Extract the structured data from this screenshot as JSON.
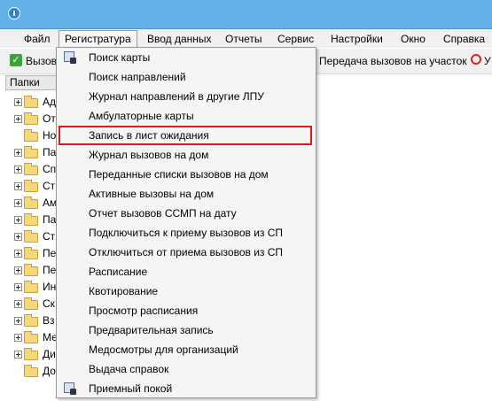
{
  "menubar": {
    "items": [
      "Файл",
      "Регистратура",
      "Ввод данных",
      "Отчеты",
      "Сервис",
      "Настройки",
      "Окно",
      "Справка"
    ]
  },
  "toolbar": {
    "left_label": "Вызов",
    "right_label": "Передача вызовов на участок",
    "extra_label": "У"
  },
  "sidepanel": {
    "header": "Папки",
    "tree": [
      "Ад",
      "От",
      "Но",
      "Па",
      "Сп",
      "Ст",
      "Ам",
      "Па",
      "Ст",
      "Пе",
      "Пе",
      "Ин",
      "Ск",
      "Вз",
      "Ме",
      "Ди",
      "До"
    ]
  },
  "dropdown": {
    "items": [
      "Поиск карты",
      "Поиск направлений",
      "Журнал направлений в другие ЛПУ",
      "Амбулаторные карты",
      "Запись в лист ожидания",
      "Журнал вызовов на дом",
      "Переданные списки вызовов на дом",
      "Активные вызовы на дом",
      "Отчет вызовов ССМП на дату",
      "Подключиться к приему вызовов из СП",
      "Отключиться от приема вызовов из СП",
      "Расписание",
      "Квотирование",
      "Просмотр расписания",
      "Предварительная запись",
      "Медосмотры для организаций",
      "Выдача справок",
      "Приемный покой"
    ],
    "highlighted_item": "Запись в лист ожидания"
  },
  "colors": {
    "titlebar": "#63b0e6",
    "highlight_border": "#e01b1b",
    "menu_background": "#f5f5f5"
  }
}
